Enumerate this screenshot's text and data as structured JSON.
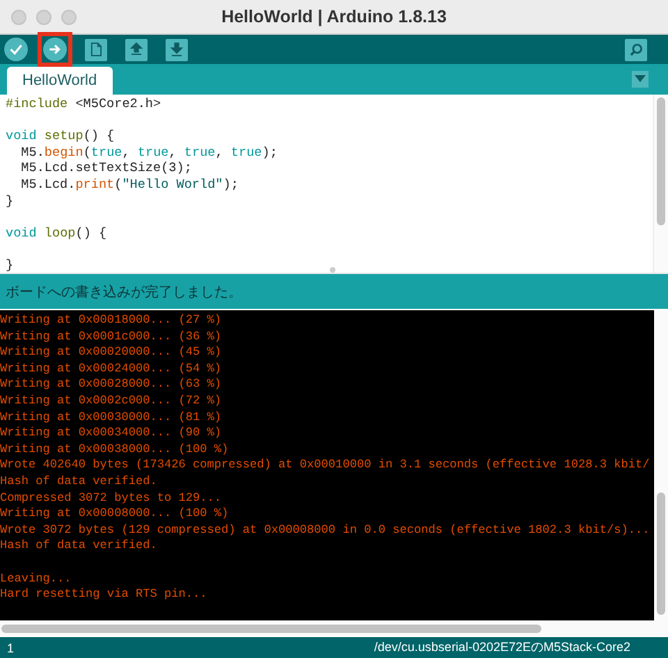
{
  "window": {
    "title": "HelloWorld | Arduino 1.8.13"
  },
  "toolbar": {
    "buttons": [
      {
        "kind": "verify",
        "highlighted": false
      },
      {
        "kind": "upload",
        "highlighted": true
      },
      {
        "kind": "new",
        "highlighted": false
      },
      {
        "kind": "open",
        "highlighted": false
      },
      {
        "kind": "save",
        "highlighted": false
      },
      {
        "kind": "serial-monitor",
        "highlighted": false
      }
    ]
  },
  "tabs": [
    {
      "label": "HelloWorld",
      "selected": true
    }
  ],
  "editor": {
    "lines": [
      {
        "kind": "code",
        "tokens": [
          {
            "text": "#include",
            "kind": "preproc"
          },
          {
            "text": " <M5Core2.h>",
            "kind": "plain"
          }
        ]
      },
      {
        "kind": "blank"
      },
      {
        "kind": "code",
        "tokens": [
          {
            "text": "void ",
            "kind": "keyword"
          },
          {
            "text": "setup",
            "kind": "function"
          },
          {
            "text": "() {",
            "kind": "plain"
          }
        ]
      },
      {
        "kind": "code",
        "tokens": [
          {
            "text": "  M5.",
            "kind": "plain"
          },
          {
            "text": "begin",
            "kind": "method"
          },
          {
            "text": "(",
            "kind": "plain"
          },
          {
            "text": "true",
            "kind": "literal"
          },
          {
            "text": ", ",
            "kind": "plain"
          },
          {
            "text": "true",
            "kind": "literal"
          },
          {
            "text": ", ",
            "kind": "plain"
          },
          {
            "text": "true",
            "kind": "literal"
          },
          {
            "text": ", ",
            "kind": "plain"
          },
          {
            "text": "true",
            "kind": "literal"
          },
          {
            "text": ");",
            "kind": "plain"
          }
        ]
      },
      {
        "kind": "code",
        "tokens": [
          {
            "text": "  M5.Lcd.setTextSize(3);",
            "kind": "plain"
          }
        ]
      },
      {
        "kind": "code",
        "tokens": [
          {
            "text": "  M5.Lcd.",
            "kind": "plain"
          },
          {
            "text": "print",
            "kind": "method"
          },
          {
            "text": "(",
            "kind": "plain"
          },
          {
            "text": "\"Hello World\"",
            "kind": "string"
          },
          {
            "text": ");",
            "kind": "plain"
          }
        ]
      },
      {
        "kind": "code",
        "tokens": [
          {
            "text": "}",
            "kind": "plain"
          }
        ]
      },
      {
        "kind": "blank"
      },
      {
        "kind": "code",
        "tokens": [
          {
            "text": "void ",
            "kind": "keyword"
          },
          {
            "text": "loop",
            "kind": "function"
          },
          {
            "text": "() {",
            "kind": "plain"
          }
        ]
      },
      {
        "kind": "blank"
      },
      {
        "kind": "code",
        "tokens": [
          {
            "text": "}",
            "kind": "plain"
          }
        ]
      }
    ]
  },
  "message": "ボードへの書き込みが完了しました。",
  "console": {
    "lines": [
      {
        "kind": "text",
        "text": "Writing at 0x00018000... (27 %)"
      },
      {
        "kind": "text",
        "text": "Writing at 0x0001c000... (36 %)"
      },
      {
        "kind": "text",
        "text": "Writing at 0x00020000... (45 %)"
      },
      {
        "kind": "text",
        "text": "Writing at 0x00024000... (54 %)"
      },
      {
        "kind": "text",
        "text": "Writing at 0x00028000... (63 %)"
      },
      {
        "kind": "text",
        "text": "Writing at 0x0002c000... (72 %)"
      },
      {
        "kind": "text",
        "text": "Writing at 0x00030000... (81 %)"
      },
      {
        "kind": "text",
        "text": "Writing at 0x00034000... (90 %)"
      },
      {
        "kind": "text",
        "text": "Writing at 0x00038000... (100 %)"
      },
      {
        "kind": "text",
        "text": "Wrote 402640 bytes (173426 compressed) at 0x00010000 in 3.1 seconds (effective 1028.3 kbit/"
      },
      {
        "kind": "text",
        "text": "Hash of data verified."
      },
      {
        "kind": "text",
        "text": "Compressed 3072 bytes to 129..."
      },
      {
        "kind": "text",
        "text": "Writing at 0x00008000... (100 %)"
      },
      {
        "kind": "text",
        "text": "Wrote 3072 bytes (129 compressed) at 0x00008000 in 0.0 seconds (effective 1802.3 kbit/s)..."
      },
      {
        "kind": "text",
        "text": "Hash of data verified."
      },
      {
        "kind": "blank"
      },
      {
        "kind": "text",
        "text": "Leaving..."
      },
      {
        "kind": "text",
        "text": "Hard resetting via RTS pin..."
      }
    ]
  },
  "status_bar": {
    "line": "1",
    "board": "/dev/cu.usbserial-0202E72EのM5Stack-Core2"
  }
}
